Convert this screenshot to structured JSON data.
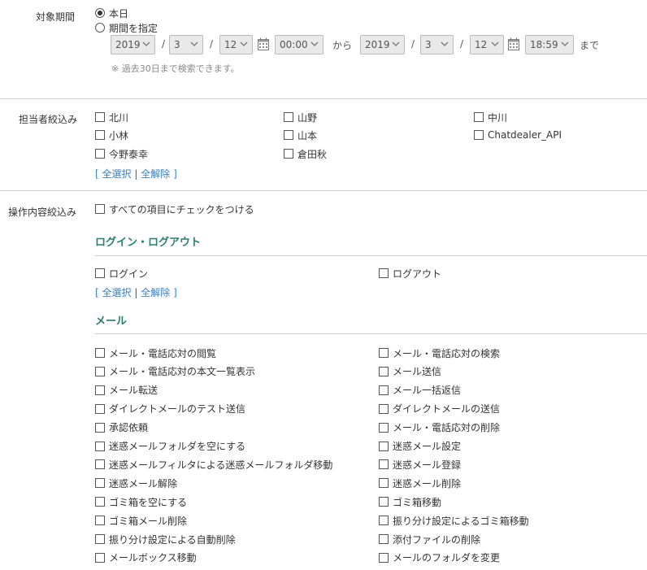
{
  "period": {
    "label": "対象期間",
    "today_label": "本日",
    "range_label": "期間を指定",
    "from": {
      "year": "2019",
      "month": "3",
      "day": "12",
      "time": "00:00"
    },
    "to": {
      "year": "2019",
      "month": "3",
      "day": "12",
      "time": "18:59"
    },
    "slash": "/",
    "kara": "から",
    "made": "まで",
    "note": "※ 過去30日まで検索できます。"
  },
  "staff": {
    "label": "担当者絞込み",
    "people": [
      "北川",
      "山野",
      "中川",
      "小林",
      "山本",
      "Chatdealer_API",
      "今野泰幸",
      "倉田秋"
    ],
    "links": {
      "open": "[",
      "select_all": "全選択",
      "bar": "|",
      "clear_all": "全解除",
      "close": "]"
    }
  },
  "operations": {
    "label": "操作内容絞込み",
    "check_all": "すべての項目にチェックをつける",
    "login": {
      "title": "ログイン・ログアウト",
      "items": [
        "ログイン",
        "ログアウト"
      ],
      "links": {
        "open": "[",
        "select_all": "全選択",
        "bar": "|",
        "clear_all": "全解除",
        "close": "]"
      }
    },
    "mail": {
      "title": "メール",
      "left": [
        "メール・電話応対の閲覧",
        "メール・電話応対の本文一覧表示",
        "メール転送",
        "ダイレクトメールのテスト送信",
        "承認依頼",
        "迷惑メールフォルダを空にする",
        "迷惑メールフィルタによる迷惑メールフォルダ移動",
        "迷惑メール解除",
        "ゴミ箱を空にする",
        "ゴミ箱メール削除",
        "振り分け設定による自動削除",
        "メールボックス移動"
      ],
      "right": [
        "メール・電話応対の検索",
        "メール送信",
        "メール一括返信",
        "ダイレクトメールの送信",
        "メール・電話応対の削除",
        "迷惑メール設定",
        "迷惑メール登録",
        "迷惑メール削除",
        "ゴミ箱移動",
        "振り分け設定によるゴミ箱移動",
        "添付ファイルの削除",
        "メールのフォルダを変更"
      ]
    }
  },
  "colors": {
    "link": "#3a7ebf",
    "category_title": "#2a7d6f",
    "divider": "#cccccc"
  }
}
